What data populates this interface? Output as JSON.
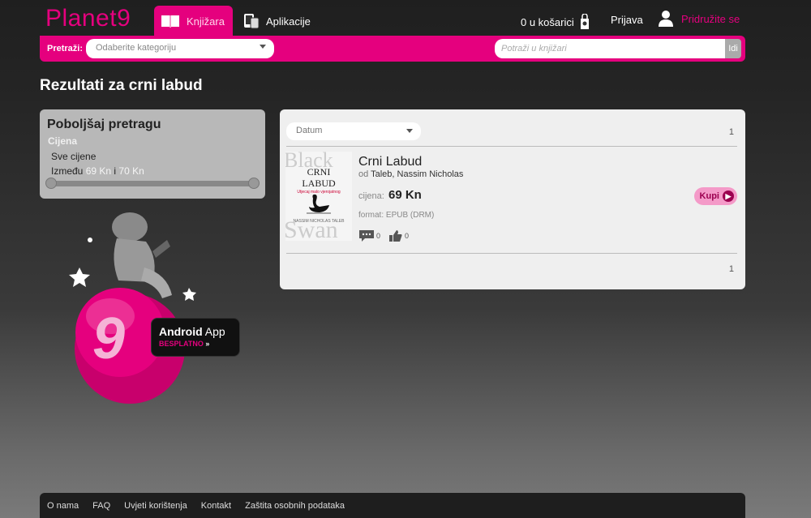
{
  "header": {
    "logo": "Planet9",
    "tabs": [
      {
        "label": "Knjižara",
        "icon": "book-icon",
        "active": true
      },
      {
        "label": "Aplikacije",
        "icon": "apps-icon",
        "active": false
      }
    ],
    "cart_label": "0 u košarici",
    "login_label": "Prijava",
    "register_label": "Pridružite se"
  },
  "search": {
    "label": "Pretraži:",
    "category_placeholder": "Odaberite kategoriju",
    "query_placeholder": "Potraži u knjižari",
    "go_label": "Idi"
  },
  "page_title": "Rezultati za crni labud",
  "filter": {
    "title": "Poboljšaj pretragu",
    "category": "Cijena",
    "all_prices": "Sve cijene",
    "range_prefix": "Između",
    "range_min": "69 Kn",
    "range_sep": "i",
    "range_max": "70 Kn"
  },
  "results": {
    "sort_value": "Datum",
    "page_top": "1",
    "page_bottom": "1",
    "items": [
      {
        "title": "Crni Labud",
        "author_prefix": "od",
        "author": "Taleb, Nassim Nicholas",
        "price_label": "cijena:",
        "price": "69 Kn",
        "format": "format: EPUB (DRM)",
        "comments": "0",
        "likes": "0",
        "buy_label": "Kupi",
        "cover": {
          "bg_top": "Black",
          "title_line1": "CRNI",
          "title_line2": "LABUD",
          "subtitle": "Utjecaj malo vjerojatnog",
          "author": "NASSIM NICHOLAS TALEB",
          "bg_bottom": "Swan"
        }
      }
    ]
  },
  "promo": {
    "badge_bold": "Android",
    "badge_rest": "App",
    "badge_sub": "BESPLATNO",
    "brand_glyph": "9"
  },
  "footer": {
    "links": [
      "O nama",
      "FAQ",
      "Uvjeti korištenja",
      "Kontakt",
      "Zaštita osobnih podataka"
    ]
  },
  "colors": {
    "brand": "#e5007e",
    "buy_button": "#f49ac8"
  }
}
